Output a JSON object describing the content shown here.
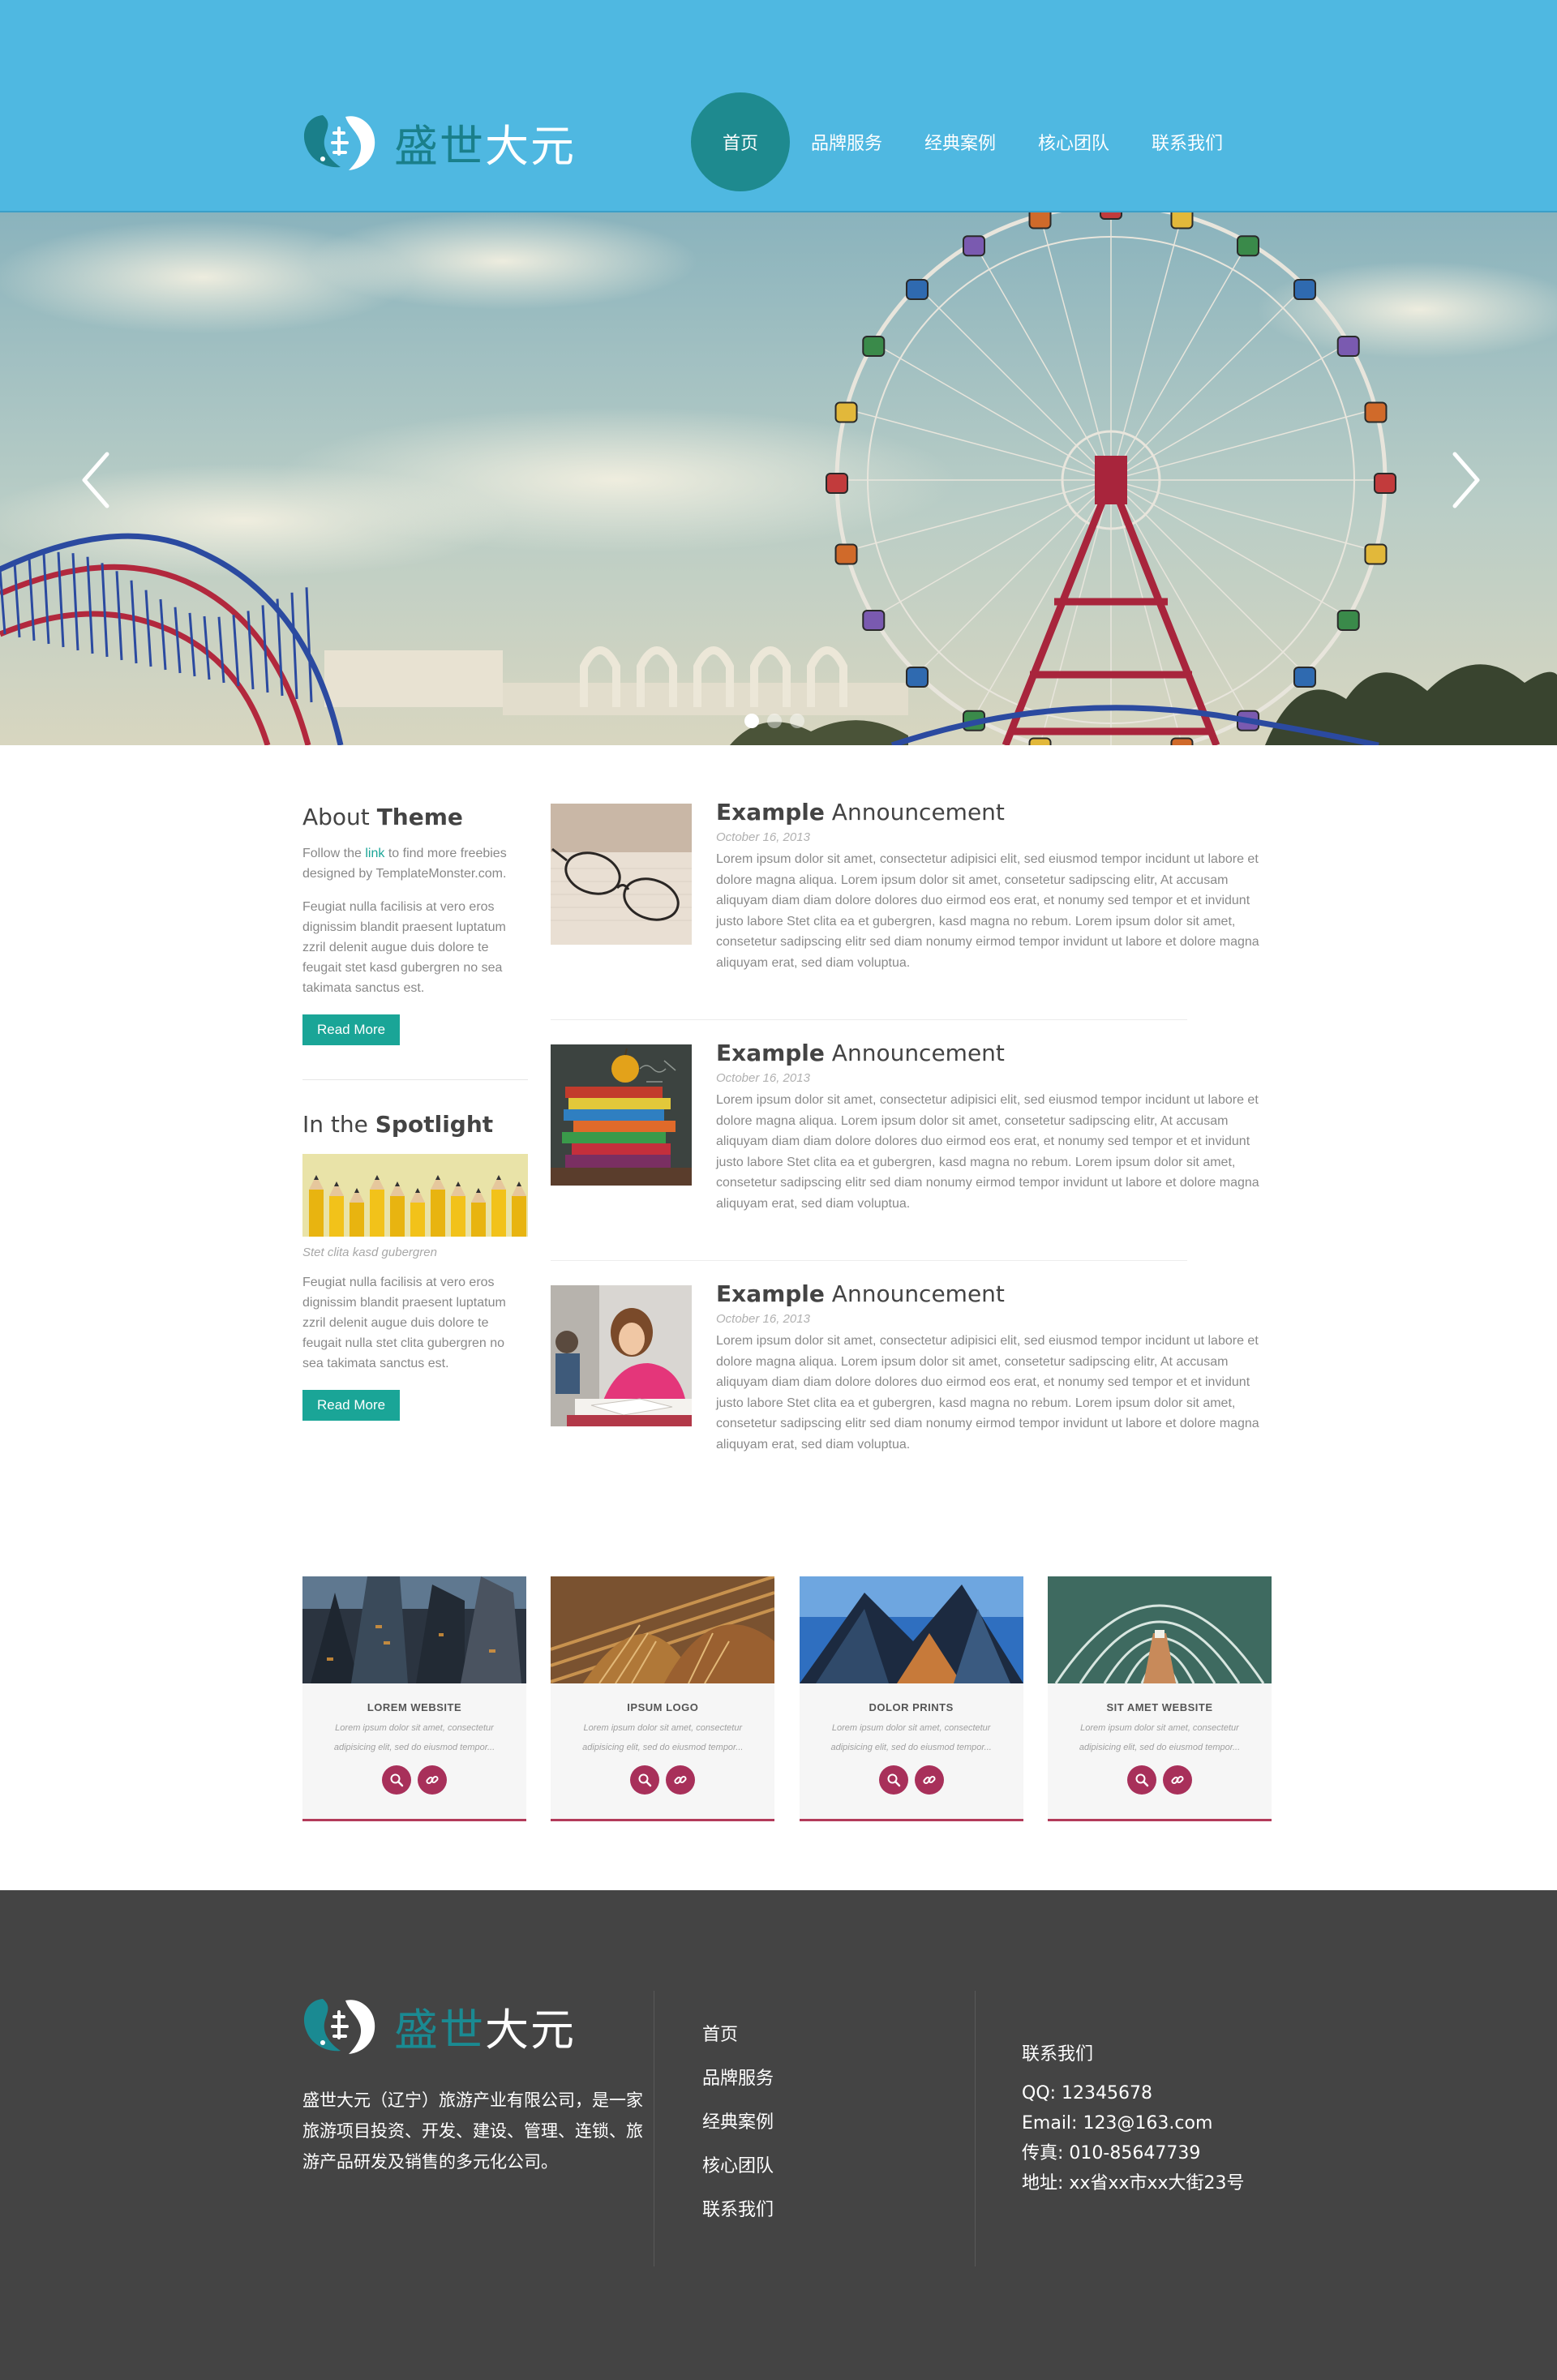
{
  "header": {
    "logo": {
      "text_accent": "盛世",
      "text_main": "大元",
      "icon": "swan-logo-icon"
    },
    "nav": [
      {
        "label": "首页",
        "active": true
      },
      {
        "label": "品牌服务",
        "active": false
      },
      {
        "label": "经典案例",
        "active": false
      },
      {
        "label": "核心团队",
        "active": false
      },
      {
        "label": "联系我们",
        "active": false
      }
    ]
  },
  "hero": {
    "prev_icon": "chevron-left-icon",
    "next_icon": "chevron-right-icon",
    "slides": 3,
    "active_slide": 1
  },
  "sidebar": {
    "about": {
      "title_plain": "About ",
      "title_bold": "Theme",
      "intro_before": "Follow the ",
      "intro_link": "link",
      "intro_after": " to find more freebies designed by TemplateMonster.com.",
      "text": "Feugiat nulla facilisis at vero eros dignissim blandit praesent luptatum zzril delenit augue duis dolore te feugait stet kasd gubergren no sea takimata sanctus est.",
      "button": "Read More"
    },
    "spotlight": {
      "title_plain": "In the ",
      "title_bold": "Spotlight",
      "caption": "Stet clita kasd gubergren",
      "text": "Feugiat nulla facilisis at vero eros dignissim blandit praesent luptatum zzril delenit augue duis dolore te feugait nulla stet clita gubergren no sea takimata sanctus est.",
      "button": "Read More"
    }
  },
  "announcements": [
    {
      "title_bold": "Example",
      "title_plain": " Announcement",
      "date": "October 16, 2013",
      "text": "Lorem ipsum dolor sit amet, consectetur adipisici elit, sed eiusmod tempor incidunt ut labore et dolore magna aliqua. Lorem ipsum dolor sit amet, consetetur sadipscing elitr, At accusam aliquyam diam diam dolore dolores duo eirmod eos erat, et nonumy sed tempor et et invidunt justo labore Stet clita ea et gubergren, kasd magna no rebum. Lorem ipsum dolor sit amet, consetetur sadipscing elitr sed diam nonumy eirmod tempor invidunt ut labore et dolore magna aliquyam erat, sed diam voluptua."
    },
    {
      "title_bold": "Example",
      "title_plain": " Announcement",
      "date": "October 16, 2013",
      "text": "Lorem ipsum dolor sit amet, consectetur adipisici elit, sed eiusmod tempor incidunt ut labore et dolore magna aliqua. Lorem ipsum dolor sit amet, consetetur sadipscing elitr, At accusam aliquyam diam diam dolore dolores duo eirmod eos erat, et nonumy sed tempor et et invidunt justo labore Stet clita ea et gubergren, kasd magna no rebum. Lorem ipsum dolor sit amet, consetetur sadipscing elitr sed diam nonumy eirmod tempor invidunt ut labore et dolore magna aliquyam erat, sed diam voluptua."
    },
    {
      "title_bold": "Example",
      "title_plain": " Announcement",
      "date": "October 16, 2013",
      "text": "Lorem ipsum dolor sit amet, consectetur adipisici elit, sed eiusmod tempor incidunt ut labore et dolore magna aliqua. Lorem ipsum dolor sit amet, consetetur sadipscing elitr, At accusam aliquyam diam diam dolore dolores duo eirmod eos erat, et nonumy sed tempor et et invidunt justo labore Stet clita ea et gubergren, kasd magna no rebum. Lorem ipsum dolor sit amet, consetetur sadipscing elitr sed diam nonumy eirmod tempor invidunt ut labore et dolore magna aliquyam erat, sed diam voluptua."
    }
  ],
  "portfolio": [
    {
      "title": "LOREM WEBSITE",
      "text": "Lorem ipsum dolor sit amet, consectetur adipisicing elit, sed do eiusmod tempor..."
    },
    {
      "title": "IPSUM LOGO",
      "text": "Lorem ipsum dolor sit amet, consectetur adipisicing elit, sed do eiusmod tempor..."
    },
    {
      "title": "DOLOR PRINTS",
      "text": "Lorem ipsum dolor sit amet, consectetur adipisicing elit, sed do eiusmod tempor..."
    },
    {
      "title": "SIT AMET WEBSITE",
      "text": "Lorem ipsum dolor sit amet, consectetur adipisicing elit, sed do eiusmod tempor..."
    }
  ],
  "footer": {
    "logo": {
      "text_accent": "盛世",
      "text_main": "大元"
    },
    "description": "盛世大元（辽宁）旅游产业有限公司，是一家旅游项目投资、开发、建设、管理、连锁、旅游产品研发及销售的多元化公司。",
    "links": [
      "首页",
      "品牌服务",
      "经典案例",
      "核心团队",
      "联系我们"
    ],
    "contact": {
      "title": "联系我们",
      "qq": "QQ: 12345678",
      "email": "Email: 123@163.com",
      "fax": "传真: 010-85647739",
      "address": "地址: xx省xx市xx大街23号"
    }
  },
  "colors": {
    "header_bg": "#4fb8e1",
    "nav_active": "#1e8a8f",
    "accent_green": "#1aa597",
    "card_accent": "#a8305a",
    "footer_bg": "#444444"
  }
}
